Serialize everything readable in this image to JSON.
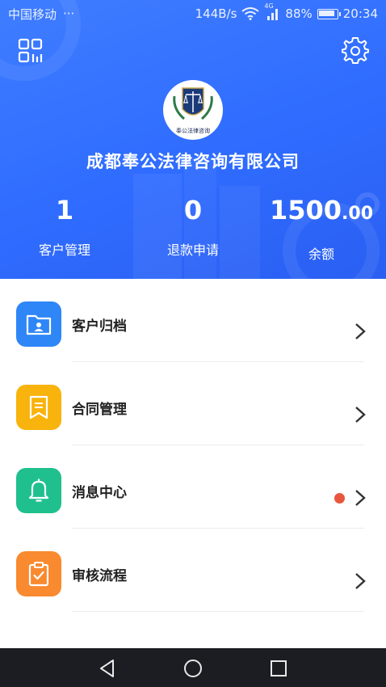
{
  "status_bar": {
    "carrier": "中国移动",
    "dots": "···",
    "speed": "144B/s",
    "network": "4G",
    "battery": "88%",
    "time": "20:34"
  },
  "header": {
    "logo_text": "奉公法律咨询",
    "company": "成都奉公法律咨询有限公司",
    "stats": [
      {
        "value": "1",
        "label": "客户管理"
      },
      {
        "value": "0",
        "label": "退款申请"
      },
      {
        "value": "1500",
        "cents": ".00",
        "label": "余额"
      }
    ]
  },
  "menu": {
    "items": [
      {
        "label": "客户归档",
        "icon": "folder-user-icon",
        "color": "#2f86f7"
      },
      {
        "label": "合同管理",
        "icon": "bookmark-doc-icon",
        "color": "#f9b30d"
      },
      {
        "label": "消息中心",
        "icon": "bell-icon",
        "color": "#1fc08e",
        "has_unread": true
      },
      {
        "label": "审核流程",
        "icon": "clipboard-check-icon",
        "color": "#f98a2f"
      }
    ]
  },
  "colors": {
    "header_blue": "#2f6cff",
    "unread_dot": "#e9563e",
    "nav_bar": "#1b1d22"
  }
}
